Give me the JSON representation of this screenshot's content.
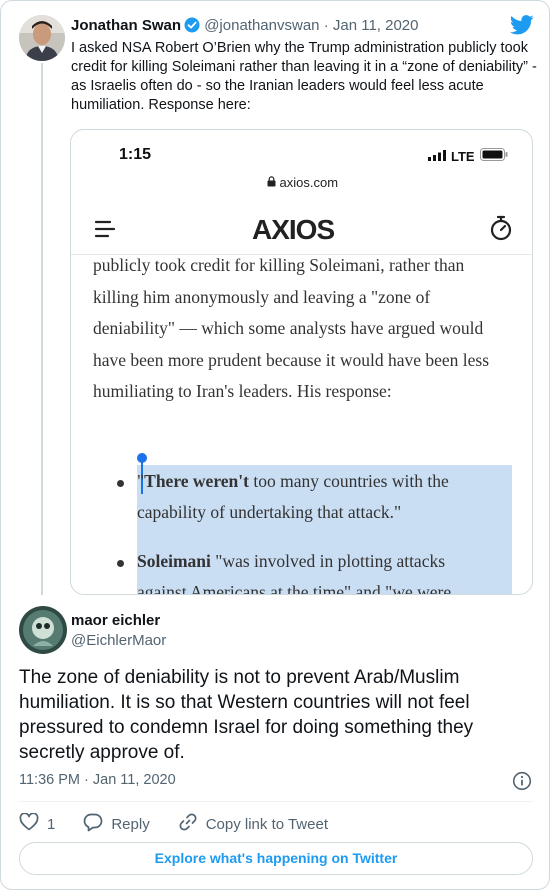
{
  "quoted_tweet": {
    "name": "Jonathan Swan",
    "handle": "@jonathanvswan",
    "separator": "·",
    "date": "Jan 11, 2020",
    "text": "I asked NSA Robert O’Brien why the Trump administration publicly took credit for killing Soleimani rather than leaving it in a “zone of deniability” - as Israelis often do - so the Iranian leaders would feel less acute humiliation. Response here:",
    "media": {
      "status_time": "1:15",
      "network": "LTE",
      "url": "axios.com",
      "site_logo": "AXIOS",
      "article_cut_line": "",
      "article_text": "publicly took credit for killing Soleimani, rather than killing him anonymously and leaving a \"zone of deniability\" — which some analysts have argued would have been more prudent because it would have been less humiliating to Iran's leaders. His response:",
      "bullet1_bold": "There weren't",
      "bullet1_rest": " too many countries with the",
      "bullet1_line2": "capability of undertaking that attack.\"",
      "bullet1_open_quote": "\"",
      "bullet2_bold": "Soleimani",
      "bullet2_rest": " \"was involved in plotting attacks",
      "bullet2_line2": "against Americans at the time\" and \"we were"
    }
  },
  "tweet": {
    "name": "maor eichler",
    "handle": "@EichlerMaor",
    "text": "The zone of deniability is not to prevent Arab/Muslim humiliation. It is so that Western countries will not feel pressured to condemn Israel for doing something they secretly approve of.",
    "time": "11:36 PM · Jan 11, 2020",
    "like_count": "1",
    "reply_label": "Reply",
    "copy_link_label": "Copy link to Tweet",
    "explore_label": "Explore what's happening on Twitter"
  },
  "colors": {
    "twitter_blue": "#1d9bf0",
    "selection": "#c9ddf3"
  },
  "icons": [
    "verified-badge-icon",
    "twitter-bird-icon",
    "signal-icon",
    "battery-icon",
    "lock-icon",
    "hamburger-icon",
    "timer-icon",
    "info-icon",
    "heart-icon",
    "reply-icon",
    "link-icon"
  ]
}
